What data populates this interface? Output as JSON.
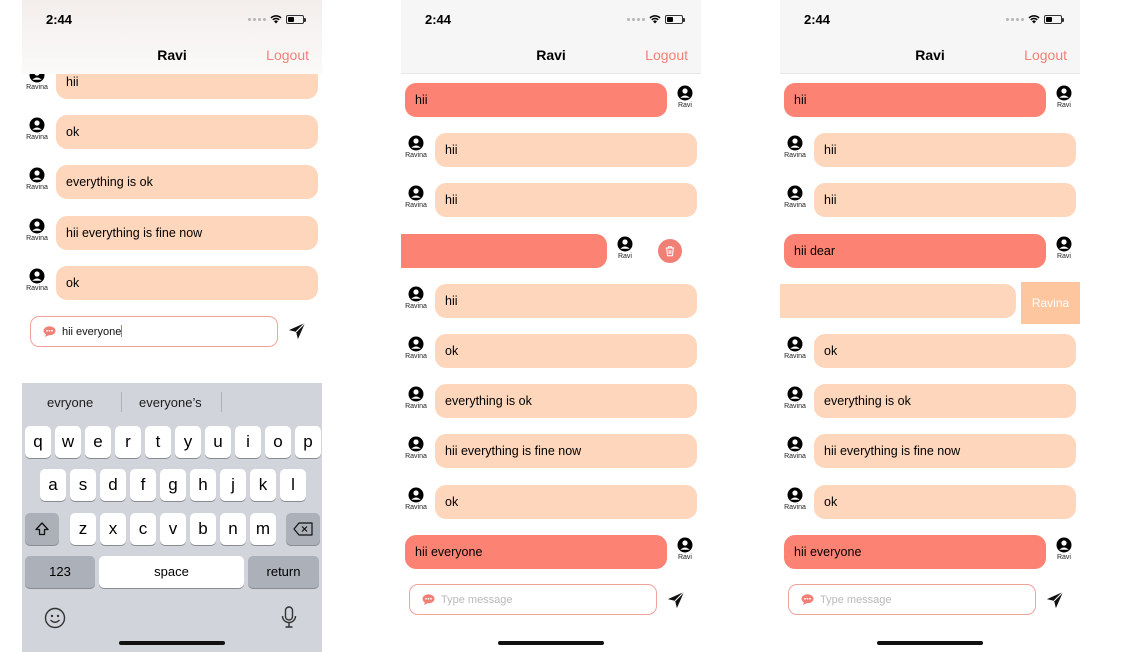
{
  "status_bar": {
    "time": "2:44"
  },
  "header": {
    "title": "Ravi",
    "logout_label": "Logout"
  },
  "screens": [
    {
      "messages": [
        {
          "text": "hii",
          "sender": "Ravina",
          "side": "in"
        },
        {
          "text": "ok",
          "sender": "Ravina",
          "side": "in"
        },
        {
          "text": "everything is ok",
          "sender": "Ravina",
          "side": "in"
        },
        {
          "text": "hii everything is fine now",
          "sender": "Ravina",
          "side": "in"
        },
        {
          "text": "ok",
          "sender": "Ravina",
          "side": "in"
        }
      ],
      "composer": {
        "value": "hii everyone"
      },
      "keyboard": {
        "suggestions": [
          "evryone",
          "everyone’s"
        ],
        "row1": [
          "q",
          "w",
          "e",
          "r",
          "t",
          "y",
          "u",
          "i",
          "o",
          "p"
        ],
        "row2": [
          "a",
          "s",
          "d",
          "f",
          "g",
          "h",
          "j",
          "k",
          "l"
        ],
        "row3": [
          "z",
          "x",
          "c",
          "v",
          "b",
          "n",
          "m"
        ],
        "numbers_label": "123",
        "space_label": "space",
        "return_label": "return"
      }
    },
    {
      "messages": [
        {
          "text": "hii",
          "sender": "Ravi",
          "side": "out"
        },
        {
          "text": "hii",
          "sender": "Ravina",
          "side": "in"
        },
        {
          "text": "hii",
          "sender": "Ravina",
          "side": "in"
        },
        {
          "text": "",
          "sender": "Ravi",
          "side": "out",
          "swiped": "delete"
        },
        {
          "text": "hii",
          "sender": "Ravina",
          "side": "in"
        },
        {
          "text": "ok",
          "sender": "Ravina",
          "side": "in"
        },
        {
          "text": "everything is ok",
          "sender": "Ravina",
          "side": "in"
        },
        {
          "text": "hii everything is fine now",
          "sender": "Ravina",
          "side": "in"
        },
        {
          "text": "ok",
          "sender": "Ravina",
          "side": "in"
        },
        {
          "text": "hii everyone",
          "sender": "Ravi",
          "side": "out"
        }
      ],
      "composer": {
        "placeholder": "Type message"
      }
    },
    {
      "messages": [
        {
          "text": "hii",
          "sender": "Ravi",
          "side": "out"
        },
        {
          "text": "hii",
          "sender": "Ravina",
          "side": "in"
        },
        {
          "text": "hii",
          "sender": "Ravina",
          "side": "in"
        },
        {
          "text": "hii dear",
          "sender": "Ravi",
          "side": "out"
        },
        {
          "text": "",
          "sender": "Ravina",
          "side": "in",
          "swiped": "sender"
        },
        {
          "text": "ok",
          "sender": "Ravina",
          "side": "in"
        },
        {
          "text": "everything is ok",
          "sender": "Ravina",
          "side": "in"
        },
        {
          "text": "hii everything is fine now",
          "sender": "Ravina",
          "side": "in"
        },
        {
          "text": "ok",
          "sender": "Ravina",
          "side": "in"
        },
        {
          "text": "hii everyone",
          "sender": "Ravi",
          "side": "out"
        }
      ],
      "composer": {
        "placeholder": "Type message"
      }
    }
  ],
  "colors": {
    "accent": "#f27f76",
    "incoming_bubble": "#fed6bb",
    "outgoing_bubble": "#fc8274",
    "swipe_label_bg": "#fec69e",
    "keyboard_bg": "#d1d4da"
  },
  "icons": {
    "avatar": "person-circle-icon",
    "send": "paper-plane-icon",
    "delete": "trash-icon",
    "composer": "chat-bubble-icon",
    "emoji": "emoji-icon",
    "mic": "microphone-icon",
    "shift": "shift-icon",
    "backspace": "backspace-icon"
  }
}
